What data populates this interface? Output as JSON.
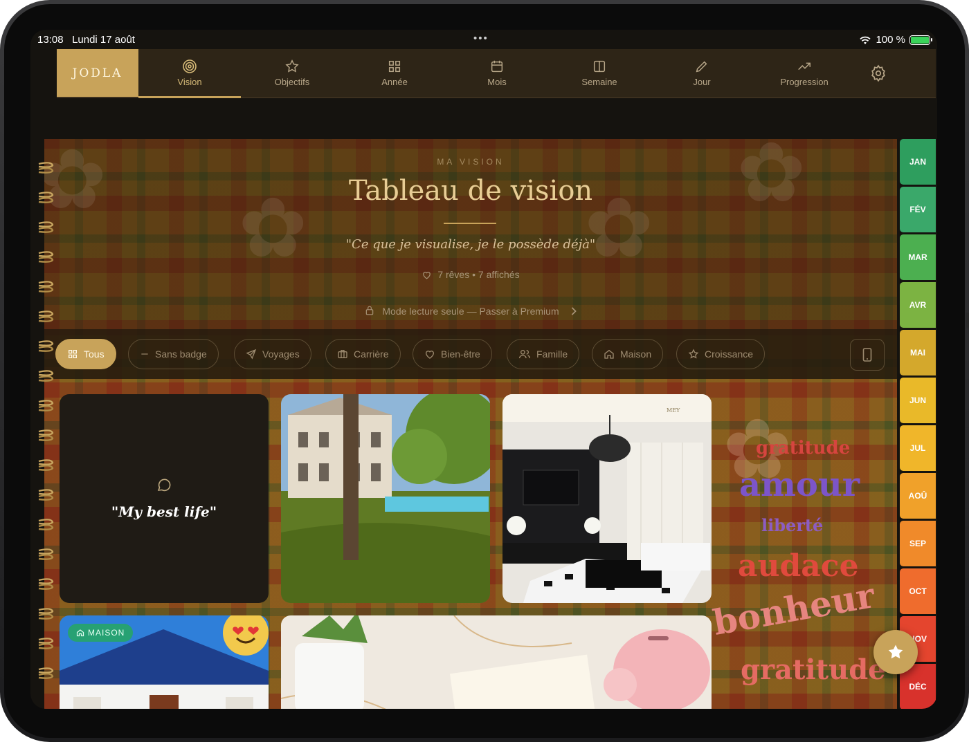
{
  "status_bar": {
    "time": "13:08",
    "date": "Lundi 17 août",
    "battery": "100 %"
  },
  "nav": {
    "brand": "JODLA",
    "tabs": [
      {
        "label": "Vision",
        "icon": "target-icon",
        "active": true
      },
      {
        "label": "Objectifs",
        "icon": "star-icon"
      },
      {
        "label": "Année",
        "icon": "grid-icon"
      },
      {
        "label": "Mois",
        "icon": "calendar-icon"
      },
      {
        "label": "Semaine",
        "icon": "columns-icon"
      },
      {
        "label": "Jour",
        "icon": "pencil-icon"
      },
      {
        "label": "Progression",
        "icon": "trend-up-icon"
      }
    ],
    "settings_icon": "gear-icon"
  },
  "hero": {
    "kicker": "MA VISION",
    "title": "Tableau de vision",
    "quote": "\"Ce que je visualise, je le possède déjà\"",
    "stats": "7 rêves • 7 affichés",
    "readonly": "Mode lecture seule — Passer à Premium"
  },
  "filters": [
    {
      "label": "Tous",
      "icon": "grid-icon",
      "active": true
    },
    {
      "label": "Sans badge",
      "icon": "minus-icon"
    },
    {
      "label": "Voyages",
      "icon": "send-icon"
    },
    {
      "label": "Carrière",
      "icon": "briefcase-icon"
    },
    {
      "label": "Bien-être",
      "icon": "heart-icon"
    },
    {
      "label": "Famille",
      "icon": "users-icon"
    },
    {
      "label": "Maison",
      "icon": "home-icon"
    },
    {
      "label": "Croissance",
      "icon": "star-icon"
    }
  ],
  "cards": {
    "note_text": "\"My best life\"",
    "maison_badge": "MAISON",
    "living_room_logo": "MEY"
  },
  "affirmations": [
    {
      "text": "gratitude",
      "color": "#d6453f"
    },
    {
      "text": "amour",
      "color": "#7c55c9"
    },
    {
      "text": "liberté",
      "color": "#8d5cc2"
    },
    {
      "text": "audace",
      "color": "#e04a3d"
    },
    {
      "text": "bonheur",
      "color": "#e6857f"
    },
    {
      "text": "gratitude",
      "color": "#e56b63"
    }
  ],
  "months": [
    {
      "label": "JAN",
      "color": "#2e9e5e"
    },
    {
      "label": "FÉV",
      "color": "#3aa86a"
    },
    {
      "label": "MAR",
      "color": "#4caf50"
    },
    {
      "label": "AVR",
      "color": "#7cb342"
    },
    {
      "label": "MAI",
      "color": "#d4a82c"
    },
    {
      "label": "JUN",
      "color": "#e9b929"
    },
    {
      "label": "JUL",
      "color": "#f0b62a"
    },
    {
      "label": "AOÛ",
      "color": "#f0a12a"
    },
    {
      "label": "SEP",
      "color": "#f08a2a"
    },
    {
      "label": "OCT",
      "color": "#ef6c2d"
    },
    {
      "label": "NOV",
      "color": "#e4452e"
    },
    {
      "label": "DÉC",
      "color": "#d8322c"
    }
  ]
}
